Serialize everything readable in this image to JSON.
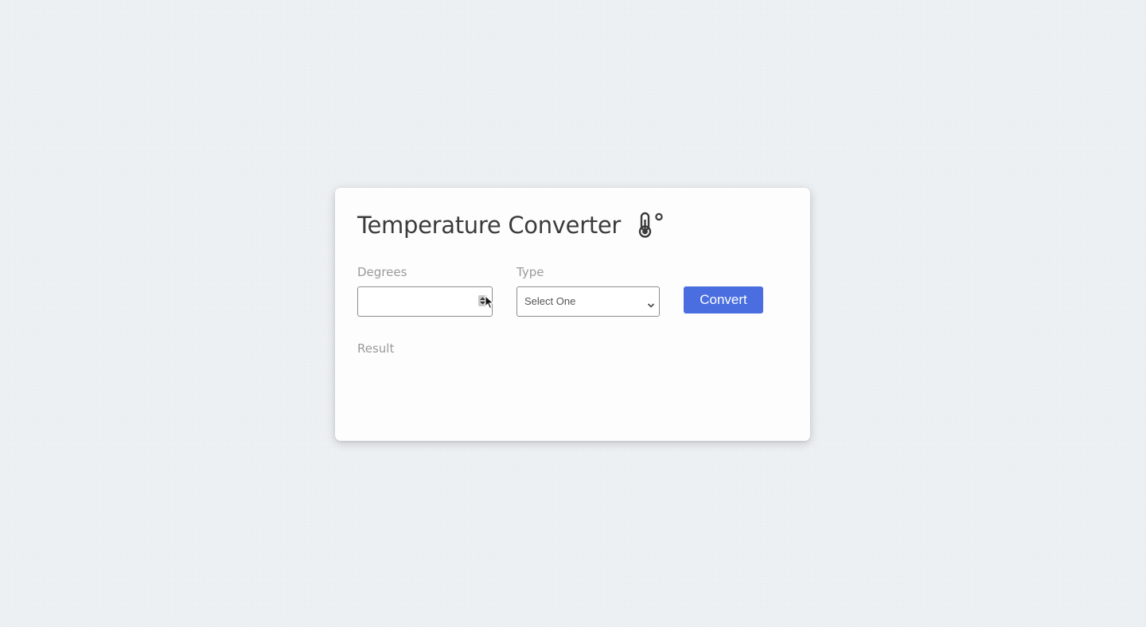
{
  "app": {
    "title": "Temperature Converter",
    "title_icon": "thermometer-degree-icon"
  },
  "form": {
    "degrees": {
      "label": "Degrees",
      "value": "",
      "placeholder": ""
    },
    "type": {
      "label": "Type",
      "selected": "Select One"
    },
    "convert_button": {
      "label": "Convert"
    },
    "result": {
      "label": "Result",
      "value": ""
    }
  },
  "colors": {
    "accent": "#4a6ee0",
    "title_text": "#3b3b3b",
    "label_text": "#9a9a9a",
    "background": "#eef1f4",
    "card": "#fdfdfd"
  }
}
